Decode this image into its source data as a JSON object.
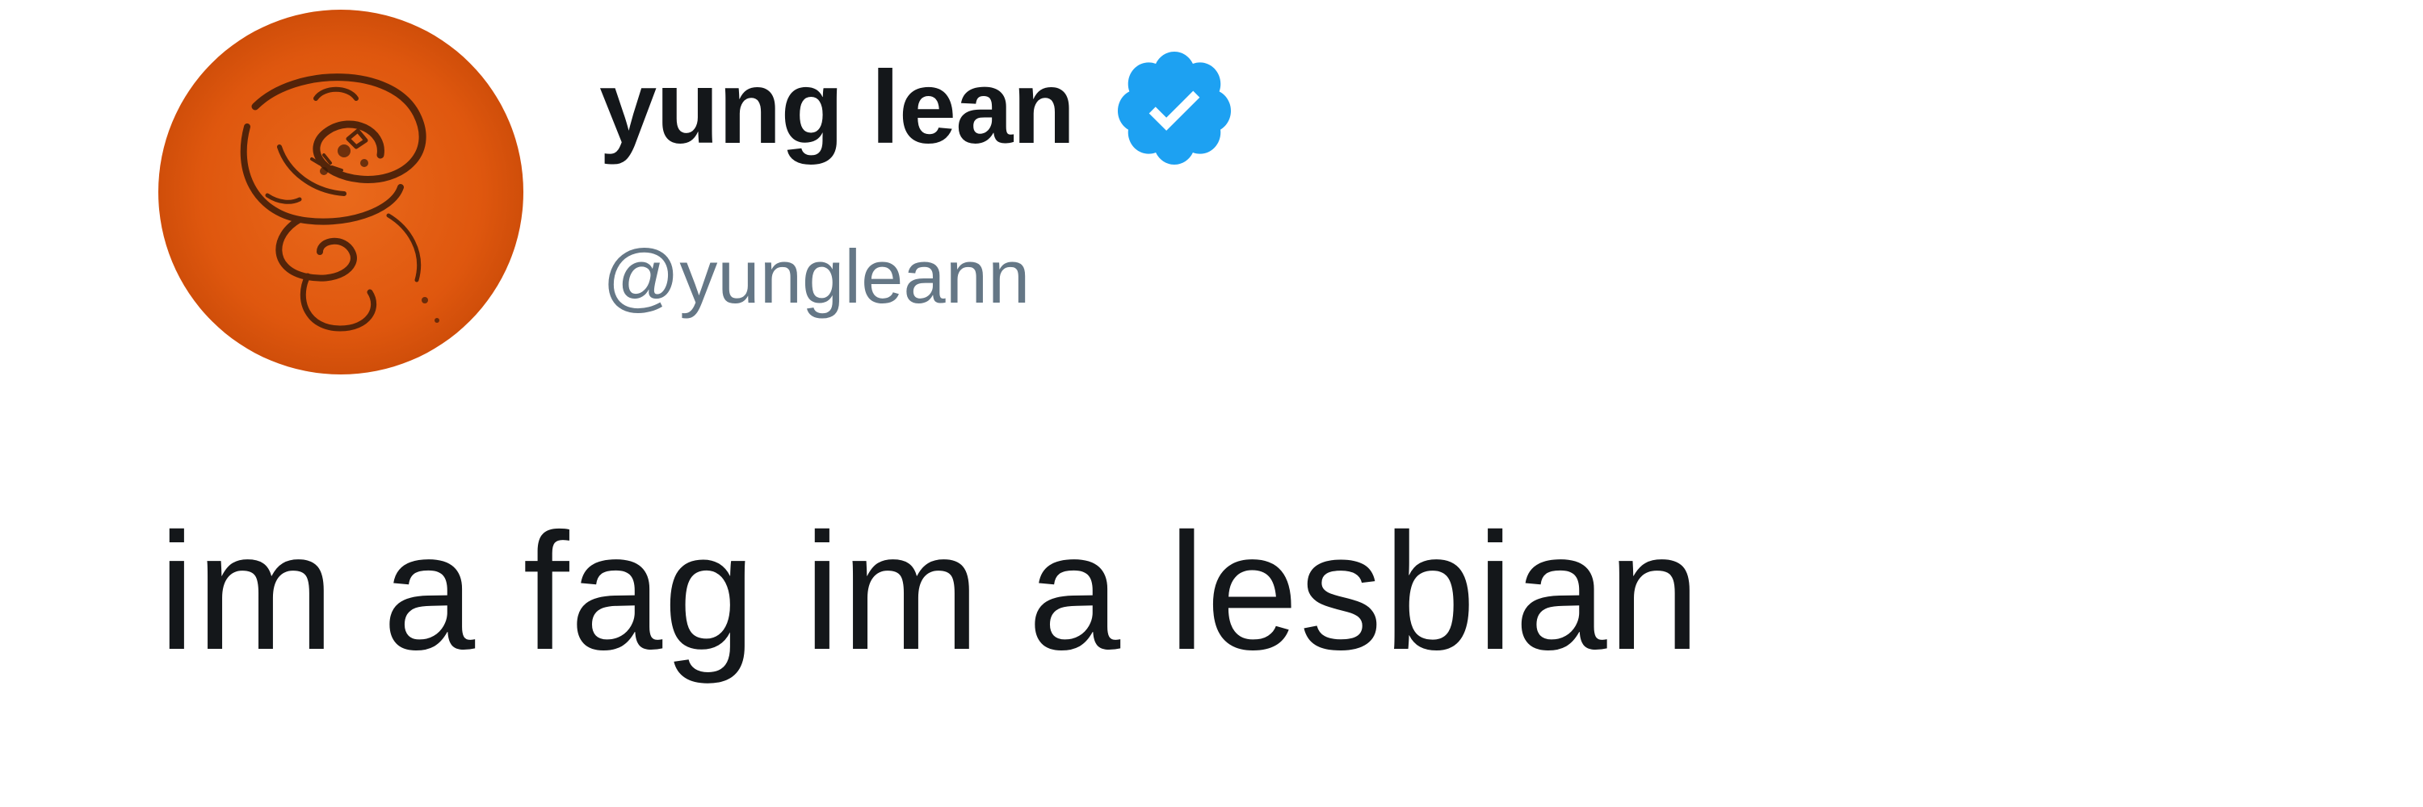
{
  "author": {
    "display_name": "yung lean",
    "handle": "@yungleann",
    "verified": true,
    "verified_icon": "verified-badge-icon",
    "avatar_icon": "avatar-image"
  },
  "tweet": {
    "text": "im a fag im a lesbian"
  },
  "colors": {
    "text_primary": "#14171a",
    "text_secondary": "#657786",
    "verified_blue": "#1da1f2",
    "avatar_orange": "#e25a0d",
    "background": "#ffffff"
  }
}
